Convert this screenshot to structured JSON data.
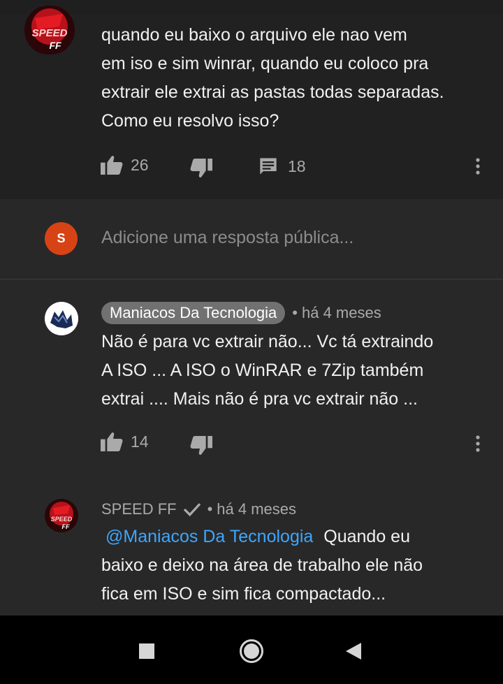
{
  "parent_comment": {
    "text_lines": [
      "quando eu baixo o arquivo ele nao vem",
      "em iso e sim winrar, quando eu coloco pra",
      "extrair ele extrai as pastas todas separadas.",
      "Como eu resolvo isso?"
    ],
    "like_count": "26",
    "reply_count": "18"
  },
  "reply_box": {
    "avatar_letter": "S",
    "placeholder": "Adicione uma resposta pública..."
  },
  "replies": [
    {
      "author": "Maniacos Da Tecnologia",
      "separator": "•",
      "time": "há 4 meses",
      "text_lines": [
        "Não é para vc extrair não... Vc tá extraindo",
        "A ISO ... A ISO o WinRAR e 7Zip  também",
        "extrai .... Mais não é pra vc extrair não ..."
      ],
      "like_count": "14"
    },
    {
      "author": "SPEED FF",
      "separator": "•",
      "time": "há 4 meses",
      "mention": "@Maniacos Da Tecnologia",
      "text_first_rest": "Quando eu",
      "text_lines": [
        "baixo e deixo na área de trabalho ele não",
        "fica em ISO e sim fica compactado..."
      ]
    }
  ],
  "avatar_logo_text": [
    "SPEED",
    "FF"
  ],
  "colors": {
    "background": "#282828",
    "parent_background": "#212121",
    "text": "#f1f1f1",
    "secondary": "#aaaaaa",
    "link": "#3ea6ff",
    "reply_avatar": "#d84315"
  },
  "icons": [
    "like-icon",
    "dislike-icon",
    "comment-icon",
    "more-vert-icon",
    "verified-check-icon",
    "nav-stop-icon",
    "nav-home-icon",
    "nav-back-icon"
  ]
}
